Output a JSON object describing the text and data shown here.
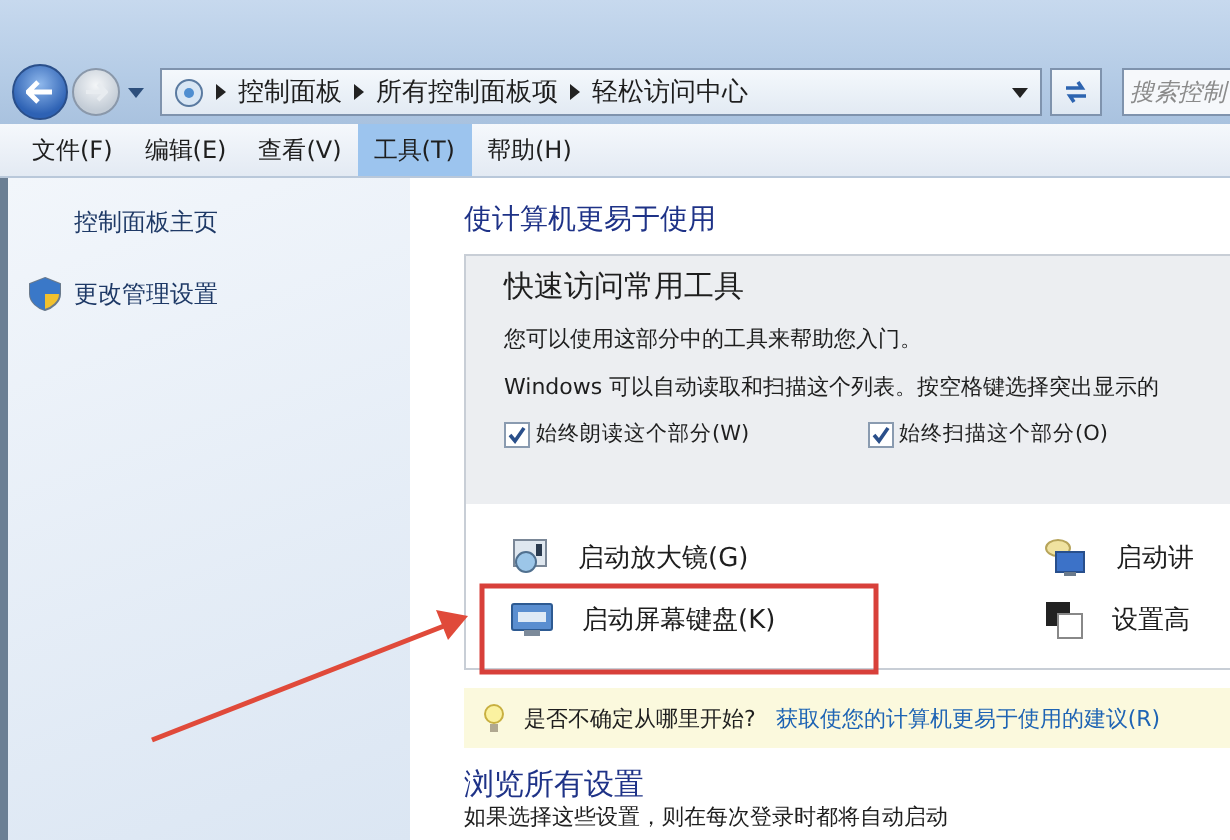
{
  "address_bar": {
    "crumbs": [
      "控制面板",
      "所有控制面板项",
      "轻松访问中心"
    ]
  },
  "search": {
    "placeholder": "搜索控制"
  },
  "menu": [
    {
      "label": "文件(F)",
      "selected": false
    },
    {
      "label": "编辑(E)",
      "selected": false
    },
    {
      "label": "查看(V)",
      "selected": false
    },
    {
      "label": "工具(T)",
      "selected": true
    },
    {
      "label": "帮助(H)",
      "selected": false
    }
  ],
  "sidebar": {
    "items": [
      {
        "label": "控制面板主页",
        "kind": "link"
      },
      {
        "label": "更改管理设置",
        "kind": "shield"
      }
    ]
  },
  "main": {
    "heading": "使计算机更易于使用",
    "quick_access": {
      "title": "快速访问常用工具",
      "lines": [
        "您可以使用这部分中的工具来帮助您入门。",
        "Windows 可以自动读取和扫描这个列表。按空格键选择突出显示的"
      ],
      "checkboxes": [
        {
          "label": "始终朗读这个部分(W)",
          "checked": true
        },
        {
          "label": "始终扫描这个部分(O)",
          "checked": true
        }
      ]
    },
    "tools": [
      {
        "label": "启动放大镜(G)",
        "kind": "magnifier"
      },
      {
        "label": "启动讲",
        "kind": "narrator"
      },
      {
        "label": "启动屏幕键盘(K)",
        "kind": "keyboard"
      },
      {
        "label": "设置高",
        "kind": "contrast"
      }
    ],
    "tip": {
      "text": "是否不确定从哪里开始?",
      "link": "获取使您的计算机更易于使用的建议(R)"
    },
    "browse": {
      "title": "浏览所有设置",
      "note": "如果选择这些设置，则在每次登录时都将自动启动"
    }
  }
}
